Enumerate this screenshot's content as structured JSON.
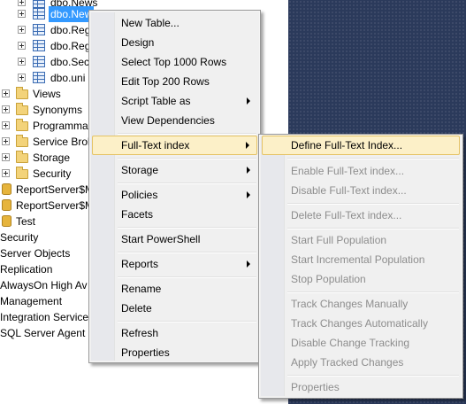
{
  "tree": {
    "rows": [
      {
        "label": "dbo.News",
        "icon": "table-icon"
      },
      {
        "label": "dbo.New",
        "icon": "table-icon",
        "selected": true
      },
      {
        "label": "dbo.Reg",
        "icon": "table-icon"
      },
      {
        "label": "dbo.Reg",
        "icon": "table-icon"
      },
      {
        "label": "dbo.Sec",
        "icon": "table-icon"
      },
      {
        "label": "dbo.uni",
        "icon": "table-icon"
      },
      {
        "label": "Views",
        "icon": "folder-icon"
      },
      {
        "label": "Synonyms",
        "icon": "folder-icon"
      },
      {
        "label": "Programma",
        "icon": "folder-icon"
      },
      {
        "label": "Service Brok",
        "icon": "folder-icon"
      },
      {
        "label": "Storage",
        "icon": "folder-icon"
      },
      {
        "label": "Security",
        "icon": "folder-icon"
      },
      {
        "label": "ReportServer$M",
        "icon": "database-icon"
      },
      {
        "label": "ReportServer$M",
        "icon": "database-icon"
      },
      {
        "label": "Test",
        "icon": "database-icon"
      },
      {
        "label": "Security"
      },
      {
        "label": "Server Objects"
      },
      {
        "label": "Replication"
      },
      {
        "label": "AlwaysOn High Av"
      },
      {
        "label": "Management"
      },
      {
        "label": "Integration Services"
      },
      {
        "label": "SQL Server Agent (A"
      }
    ]
  },
  "context_menu": {
    "items": [
      {
        "label": "New Table..."
      },
      {
        "label": "Design"
      },
      {
        "label": "Select Top 1000 Rows"
      },
      {
        "label": "Edit Top 200 Rows"
      },
      {
        "label": "Script Table as",
        "submenu": true
      },
      {
        "label": "View Dependencies"
      },
      {
        "label": "Full-Text index",
        "submenu": true,
        "highlighted": true
      },
      {
        "label": "Storage",
        "submenu": true
      },
      {
        "label": "Policies",
        "submenu": true
      },
      {
        "label": "Facets"
      },
      {
        "label": "Start PowerShell"
      },
      {
        "label": "Reports",
        "submenu": true
      },
      {
        "label": "Rename"
      },
      {
        "label": "Delete"
      },
      {
        "label": "Refresh"
      },
      {
        "label": "Properties"
      }
    ]
  },
  "fulltext_submenu": {
    "items": [
      {
        "label": "Define Full-Text Index...",
        "highlighted": true
      },
      {
        "label": "Enable Full-Text index...",
        "disabled": true
      },
      {
        "label": "Disable Full-Text index...",
        "disabled": true
      },
      {
        "label": "Delete Full-Text index...",
        "disabled": true
      },
      {
        "label": "Start Full Population",
        "disabled": true
      },
      {
        "label": "Start Incremental Population",
        "disabled": true
      },
      {
        "label": "Stop Population",
        "disabled": true
      },
      {
        "label": "Track Changes Manually",
        "disabled": true
      },
      {
        "label": "Track Changes Automatically",
        "disabled": true
      },
      {
        "label": "Disable Change Tracking",
        "disabled": true
      },
      {
        "label": "Apply Tracked Changes",
        "disabled": true
      },
      {
        "label": "Properties",
        "disabled": true
      }
    ]
  },
  "colors": {
    "selection": "#3399ff",
    "menu_highlight": "#fcf0c8",
    "menu_highlight_border": "#e5c365",
    "disabled_text": "#8d8d8d",
    "background_right": "#2b3a5b"
  }
}
